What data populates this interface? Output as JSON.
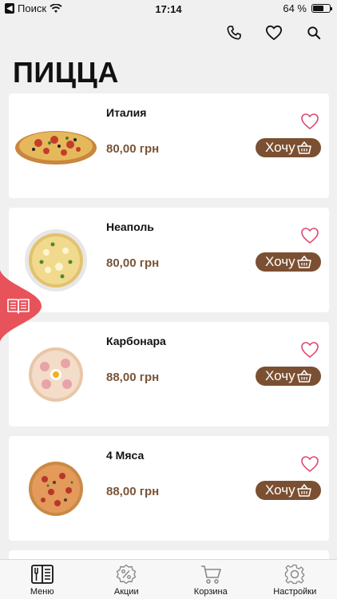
{
  "status": {
    "back_label": "Поиск",
    "time": "17:14",
    "battery": "64 %",
    "battery_level": 0.64
  },
  "header": {
    "title": "ПИЦЦА",
    "icons": [
      "phone-icon",
      "heart-icon",
      "search-icon"
    ]
  },
  "items": [
    {
      "name": "Италия",
      "price": "80,00 грн",
      "button": "Хочу"
    },
    {
      "name": "Неаполь",
      "price": "80,00 грн",
      "button": "Хочу"
    },
    {
      "name": "Карбонара",
      "price": "88,00 грн",
      "button": "Хочу"
    },
    {
      "name": "4 Мяса",
      "price": "88,00 грн",
      "button": "Хочу"
    }
  ],
  "nav": {
    "menu": "Меню",
    "promos": "Акции",
    "cart": "Корзина",
    "settings": "Настройки"
  },
  "colors": {
    "accent_brown": "#7b5032",
    "heart_pink": "#e0456f",
    "side_tab_red": "#e8525a"
  }
}
